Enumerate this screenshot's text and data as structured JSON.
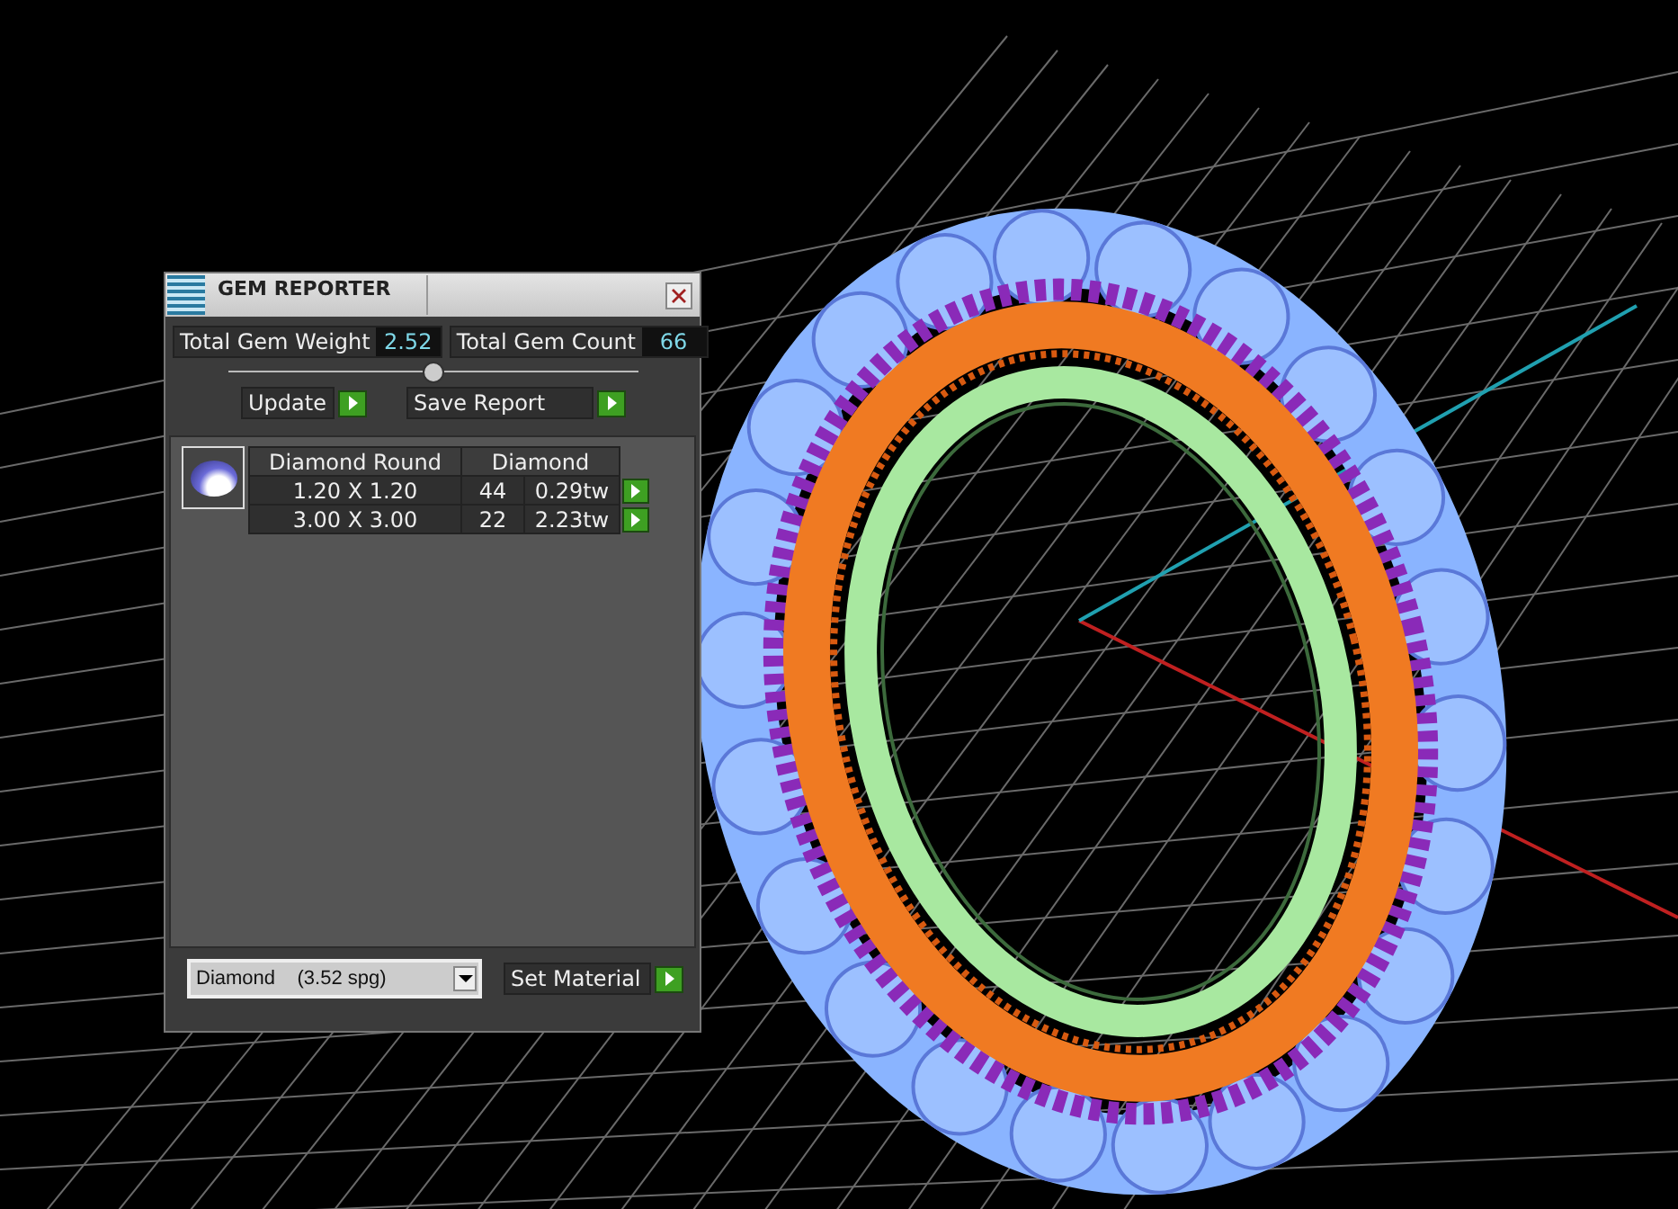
{
  "window": {
    "title": "GEM REPORTER"
  },
  "totals": [
    {
      "label": "Total Gem Weight",
      "value": "2.52"
    },
    {
      "label": "Total Gem Count",
      "value": "66"
    }
  ],
  "buttons": [
    {
      "label": "Update"
    },
    {
      "label": "Save Report"
    }
  ],
  "table": {
    "header": [
      "Diamond Round",
      "Diamond"
    ],
    "rows": [
      {
        "size": "1.20 X 1.20",
        "count": "44",
        "weight": "0.29tw"
      },
      {
        "size": "3.00 X 3.00",
        "count": "22",
        "weight": "2.23tw"
      }
    ]
  },
  "material": {
    "value": "Diamond    (3.52 spg)",
    "button": "Set Material"
  }
}
